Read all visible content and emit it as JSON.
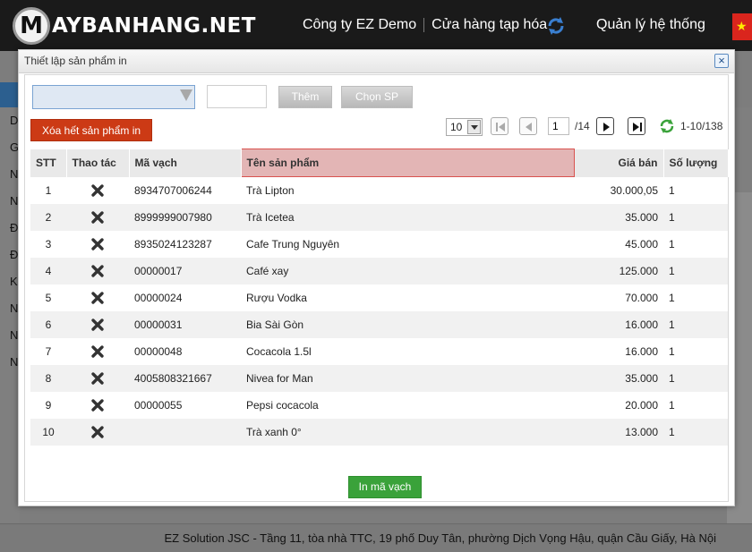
{
  "header": {
    "logo_letter": "M",
    "logo_text": "AYBANHANG.NET",
    "company": "Công ty EZ Demo",
    "store": "Cửa hàng tạp hóa",
    "admin": "Quản lý hệ thống"
  },
  "background_sidebar": [
    "D",
    "G",
    "N",
    "N",
    "Đ",
    "Đ",
    "K",
    "N",
    "N",
    "N"
  ],
  "footer": {
    "text": "EZ Solution JSC - Tầng 11, tòa nhà TTC, 19 phố Duy Tân, phường Dịch Vọng Hậu, quận Cầu Giấy, Hà Nội"
  },
  "dialog": {
    "title": "Thiết lập sản phẩm in",
    "close_label": "×",
    "qty_value": "",
    "add_label": "Thêm",
    "choose_label": "Chọn SP",
    "clear_label": "Xóa hết sản phẩm in",
    "print_label": "In mã vạch"
  },
  "pager": {
    "page_size": "10",
    "current_page": "1",
    "total_pages": "/14",
    "range": "1-10/138"
  },
  "table": {
    "columns": {
      "stt": "STT",
      "action": "Thao tác",
      "barcode": "Mã vạch",
      "name": "Tên sản phẩm",
      "price": "Giá bán",
      "qty": "Số lượng"
    },
    "rows": [
      {
        "stt": "1",
        "barcode": "8934707006244",
        "name": "Trà Lipton",
        "price": "30.000,05",
        "qty": "1"
      },
      {
        "stt": "2",
        "barcode": "8999999007980",
        "name": "Trà Icetea",
        "price": "35.000",
        "qty": "1"
      },
      {
        "stt": "3",
        "barcode": "8935024123287",
        "name": "Cafe Trung Nguyên",
        "price": "45.000",
        "qty": "1"
      },
      {
        "stt": "4",
        "barcode": "00000017",
        "name": "Café xay",
        "price": "125.000",
        "qty": "1"
      },
      {
        "stt": "5",
        "barcode": "00000024",
        "name": "Rượu Vodka",
        "price": "70.000",
        "qty": "1"
      },
      {
        "stt": "6",
        "barcode": "00000031",
        "name": "Bia Sài Gòn",
        "price": "16.000",
        "qty": "1"
      },
      {
        "stt": "7",
        "barcode": "00000048",
        "name": "Cocacola 1.5l",
        "price": "16.000",
        "qty": "1"
      },
      {
        "stt": "8",
        "barcode": "4005808321667",
        "name": "Nivea for Man",
        "price": "35.000",
        "qty": "1"
      },
      {
        "stt": "9",
        "barcode": "00000055",
        "name": "Pepsi cocacola",
        "price": "20.000",
        "qty": "1"
      },
      {
        "stt": "10",
        "barcode": "",
        "name": "Trà xanh 0°",
        "price": "13.000",
        "qty": "1"
      }
    ]
  },
  "colors": {
    "topbar": "#1a1a1a",
    "clear_button": "#cc3a15",
    "print_button": "#3aa23a",
    "highlight_header": "#e3b5b5",
    "delete_icon": "#333333"
  },
  "icons": {
    "sync": "sync-icon",
    "close": "close-icon",
    "delete": "delete-x-icon",
    "first": "first-page-icon",
    "prev": "prev-page-icon",
    "next": "next-page-icon",
    "last": "last-page-icon",
    "refresh": "refresh-icon"
  }
}
